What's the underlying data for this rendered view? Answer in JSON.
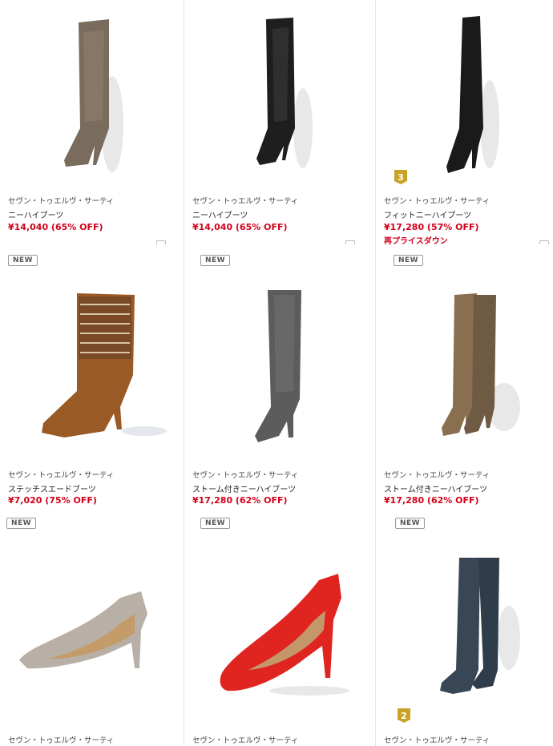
{
  "products": [
    {
      "brand": "セヴン・トゥエルヴ・サーティ",
      "name": "ニーハイブーツ",
      "price": "¥14,040 (65% OFF)",
      "note": "",
      "badge": "",
      "rank": ""
    },
    {
      "brand": "セヴン・トゥエルヴ・サーティ",
      "name": "ニーハイブーツ",
      "price": "¥14,040 (65% OFF)",
      "note": "",
      "badge": "",
      "rank": ""
    },
    {
      "brand": "セヴン・トゥエルヴ・サーティ",
      "name": "フィットニーハイブーツ",
      "price": "¥17,280 (57% OFF)",
      "note": "再プライスダウン",
      "badge": "",
      "rank": "3"
    },
    {
      "brand": "セヴン・トゥエルヴ・サーティ",
      "name": "ステッチスエードブーツ",
      "price": "¥7,020 (75% OFF)",
      "note": "",
      "badge": "NEW",
      "rank": ""
    },
    {
      "brand": "セヴン・トゥエルヴ・サーティ",
      "name": "ストーム付きニーハイブーツ",
      "price": "¥17,280 (62% OFF)",
      "note": "",
      "badge": "NEW",
      "rank": ""
    },
    {
      "brand": "セヴン・トゥエルヴ・サーティ",
      "name": "ストーム付きニーハイブーツ",
      "price": "¥17,280 (62% OFF)",
      "note": "",
      "badge": "NEW",
      "rank": ""
    },
    {
      "brand": "セヴン・トゥエルヴ・サーティ",
      "name": "",
      "price": "",
      "note": "",
      "badge": "NEW",
      "rank": ""
    },
    {
      "brand": "セヴン・トゥエルヴ・サーティ",
      "name": "",
      "price": "",
      "note": "",
      "badge": "NEW",
      "rank": ""
    },
    {
      "brand": "セヴン・トゥエルヴ・サーティ",
      "name": "",
      "price": "",
      "note": "",
      "badge": "NEW",
      "rank": "2"
    }
  ],
  "colors": {
    "price": "#d0021b",
    "rank_gold": "#c9a227"
  }
}
